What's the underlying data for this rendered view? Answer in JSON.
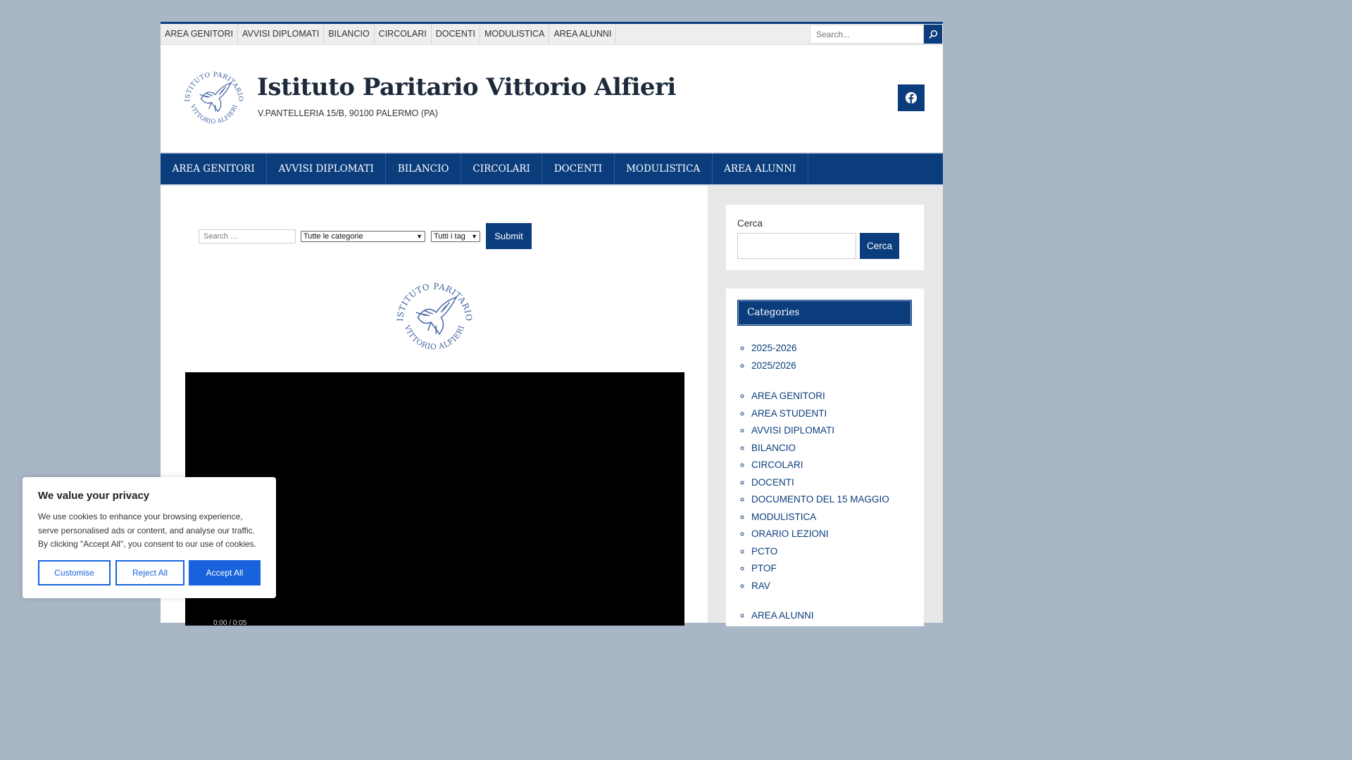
{
  "topbar": {
    "nav": [
      "AREA GENITORI",
      "AVVISI DIPLOMATI",
      "BILANCIO",
      "CIRCOLARI",
      "DOCENTI",
      "MODULISTICA",
      "AREA ALUNNI"
    ],
    "search_placeholder": "Search..."
  },
  "header": {
    "title": "Istituto Paritario Vittorio Alfieri",
    "description": "V.PANTELLERIA 15/B, 90100 PALERMO (PA)",
    "logo_text_top": "ISTITUTO PARITARIO",
    "logo_text_bottom": "VITTORIO ALFIERI"
  },
  "mainnav": [
    "AREA GENITORI",
    "AVVISI DIPLOMATI",
    "BILANCIO",
    "CIRCOLARI",
    "DOCENTI",
    "MODULISTICA",
    "AREA ALUNNI"
  ],
  "filter": {
    "search_placeholder": "Search …",
    "category_selected": "Tutte le categorie",
    "tag_selected": "Tutti i tag",
    "submit_label": "Submit"
  },
  "video": {
    "time": "0:00 / 0:05"
  },
  "sidebar": {
    "search_label": "Cerca",
    "search_button": "Cerca",
    "categories_title": "Categories",
    "group1": [
      "2025-2026",
      "2025/2026"
    ],
    "group2": [
      "AREA GENITORI",
      "AREA STUDENTI",
      "AVVISI DIPLOMATI",
      "BILANCIO",
      "CIRCOLARI",
      "DOCENTI",
      "DOCUMENTO DEL 15 MAGGIO",
      "MODULISTICA",
      "ORARIO LEZIONI",
      "PCTO",
      "PTOF",
      "RAV"
    ],
    "group3": [
      "AREA ALUNNI"
    ]
  },
  "cookie": {
    "title": "We value your privacy",
    "text": "We use cookies to enhance your browsing experience, serve personalised ads or content, and analyse our traffic. By clicking \"Accept All\", you consent to our use of cookies.",
    "customise": "Customise",
    "reject": "Reject All",
    "accept": "Accept All"
  },
  "colors": {
    "brand": "#0b3d7d",
    "cookie_accent": "#1863dc",
    "background": "#a9b6c5"
  }
}
